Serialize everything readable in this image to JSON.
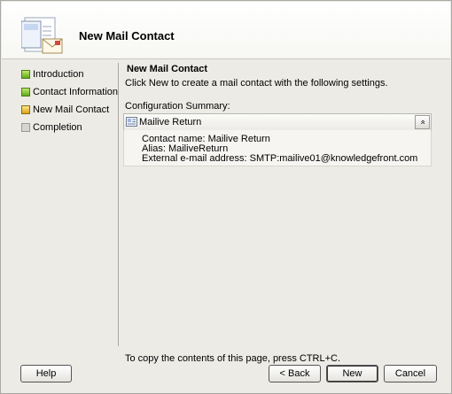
{
  "header": {
    "title": "New Mail Contact"
  },
  "nav": {
    "items": [
      {
        "label": "Introduction",
        "state": "green"
      },
      {
        "label": "Contact Information",
        "state": "green"
      },
      {
        "label": "New Mail Contact",
        "state": "yellow"
      },
      {
        "label": "Completion",
        "state": "gray"
      }
    ]
  },
  "main": {
    "title": "New Mail Contact",
    "description": "Click New to create a mail contact with the following settings.",
    "config_label": "Configuration Summary:",
    "summary": {
      "title": "Mailive Return",
      "collapse_glyph": "»",
      "details": [
        "Contact name: Mailive Return",
        "Alias: MailiveReturn",
        "External e-mail address: SMTP:mailive01@knowledgefront.com"
      ]
    },
    "copy_hint": "To copy the contents of this page, press CTRL+C."
  },
  "buttons": {
    "help": "Help",
    "back": "< Back",
    "new": "New",
    "cancel": "Cancel"
  },
  "colors": {
    "bullet_green": "#6fbf2a",
    "bullet_yellow": "#e8b41f",
    "bullet_gray": "#d6d6d0"
  }
}
